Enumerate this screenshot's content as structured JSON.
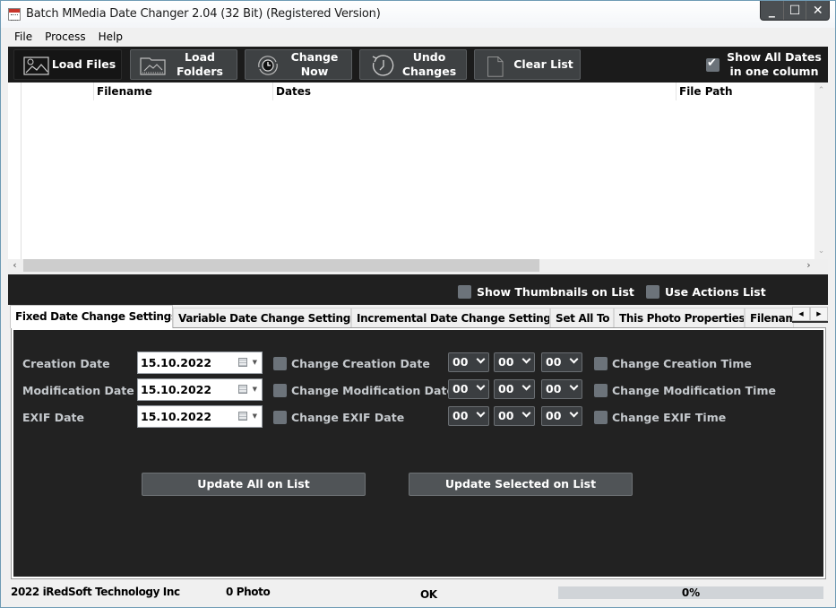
{
  "window": {
    "title": "Batch MMedia Date Changer 2.04 (32 Bit) (Registered Version)",
    "controls": {
      "minimize": "_",
      "maximize": "☐",
      "close": "✕"
    }
  },
  "menu": [
    "File",
    "Process",
    "Help"
  ],
  "toolbar": {
    "buttons": [
      {
        "id": "load-files",
        "label": "Load Files",
        "icon": "image-gear-icon",
        "active": true
      },
      {
        "id": "load-folders",
        "label": "Load Folders",
        "icon": "folder-image-icon",
        "active": false
      },
      {
        "id": "change-now",
        "label": "Change Now",
        "icon": "clock-refresh-icon",
        "active": false
      },
      {
        "id": "undo-changes",
        "label": "Undo Changes",
        "icon": "clock-undo-icon",
        "active": false
      },
      {
        "id": "clear-list",
        "label": "Clear List",
        "icon": "blank-document-icon",
        "active": false
      }
    ],
    "show_all_dates": {
      "label": "Show All Dates in one column",
      "checked": true
    }
  },
  "grid": {
    "columns": [
      "Filename",
      "Dates",
      "File Path"
    ],
    "rows": []
  },
  "options": {
    "show_thumbnails": {
      "label": "Show Thumbnails on List",
      "checked": false
    },
    "use_actions_list": {
      "label": "Use Actions List",
      "checked": false
    }
  },
  "tabs": [
    {
      "label": "Fixed Date Change Settings",
      "active": true
    },
    {
      "label": "Variable Date Change Settings",
      "active": false
    },
    {
      "label": "Incremental Date Change Settings",
      "active": false
    },
    {
      "label": "Set All To",
      "active": false
    },
    {
      "label": "This Photo Properties",
      "active": false
    },
    {
      "label": "Filenam",
      "active": false
    }
  ],
  "fixed_settings": {
    "rows": [
      {
        "label": "Creation Date",
        "date": "15.10.2022",
        "date_check_label": "Change Creation Date",
        "date_checked": false,
        "hour": "00",
        "minute": "00",
        "second": "00",
        "time_check_label": "Change Creation Time",
        "time_checked": false
      },
      {
        "label": "Modification Date",
        "date": "15.10.2022",
        "date_check_label": "Change Modification Date",
        "date_checked": false,
        "hour": "00",
        "minute": "00",
        "second": "00",
        "time_check_label": "Change Modification Time",
        "time_checked": false
      },
      {
        "label": "EXIF Date",
        "date": "15.10.2022",
        "date_check_label": "Change EXIF Date",
        "date_checked": false,
        "hour": "00",
        "minute": "00",
        "second": "00",
        "time_check_label": "Change EXIF Time",
        "time_checked": false
      }
    ],
    "update_all_label": "Update All on List",
    "update_selected_label": "Update Selected on List"
  },
  "status": {
    "copyright": "2022 iRedSoft Technology Inc",
    "count": "0 Photo",
    "state": "OK",
    "progress_percent": 0,
    "progress_text": "0%"
  },
  "colors": {
    "toolbar_bg": "#1b1b1b",
    "panel_bg": "#222222",
    "button_bg": "#3e4143",
    "checkbox": "#6c737a"
  }
}
